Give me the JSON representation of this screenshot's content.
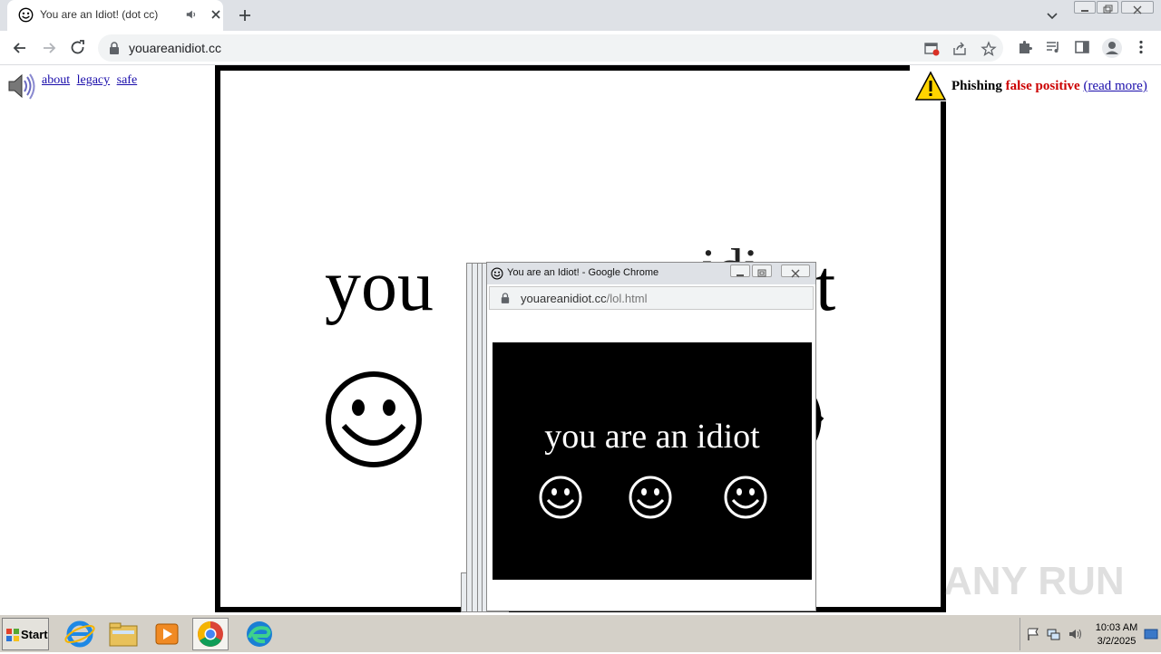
{
  "browser": {
    "tab_title": "You are an Idiot! (dot cc)",
    "url": "youareanidiot.cc"
  },
  "page": {
    "links": [
      "about",
      "legacy",
      "safe"
    ],
    "big_words": {
      "left": "you",
      "right_partial": "t",
      "middle_partial": "idi"
    },
    "phishing": {
      "label": "Phishing",
      "status": "false positive",
      "link": "(read more)"
    }
  },
  "popup": {
    "title": "You are an Idiot! - Google Chrome",
    "url_host": "youareanidiot.cc",
    "url_path": "/lol.html",
    "content_text": "you are an idiot"
  },
  "taskbar": {
    "start_label": "Start",
    "time": "10:03 AM",
    "date": "3/2/2025"
  },
  "watermark": "ANY RUN",
  "colors": {
    "chrome_frame": "#dee1e6",
    "link": "#1a0dab",
    "warning_red": "#cc0000"
  }
}
